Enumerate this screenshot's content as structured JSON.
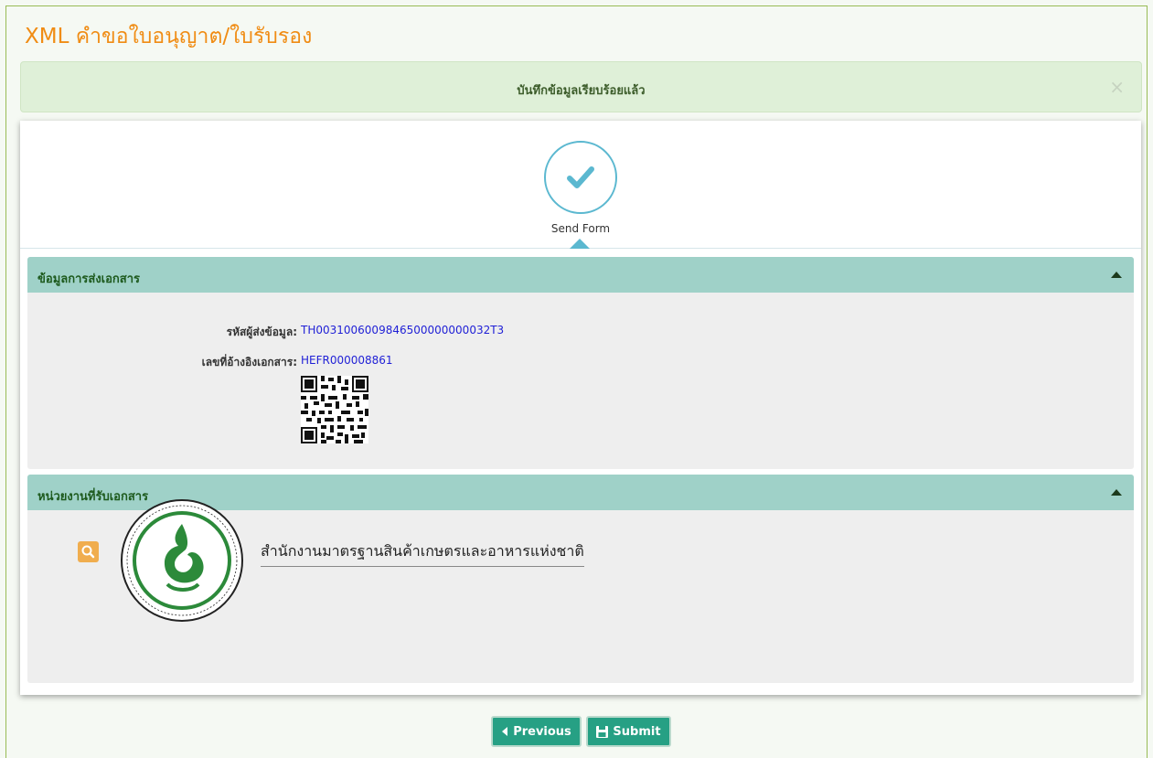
{
  "page": {
    "title": "XML คำขอใบอนุญาต/ใบรับรอง"
  },
  "alert": {
    "message": "บันทึกข้อมูลเรียบร้อยแล้ว",
    "close_symbol": "×"
  },
  "wizard": {
    "step_label": "Send Form",
    "step_icon": "check-icon",
    "accent_color": "#5bb8d0"
  },
  "sections": {
    "document_info": {
      "title": "ข้อมูลการส่งเอกสาร",
      "fields": [
        {
          "label": "รหัสผู้ส่งข้อมูล:",
          "value": "TH0031006009846500000000032T3"
        },
        {
          "label": "เลขที่อ้างอิงเอกสาร:",
          "value": "HEFR000008861"
        }
      ],
      "qr_icon": "qr-code-icon"
    },
    "receiving_agency": {
      "title": "หน่วยงานที่รับเอกสาร",
      "agency_name": "สำนักงานมาตรฐานสินค้าเกษตรและอาหารแห่งชาติ",
      "seal_text": "สำนักงานมาตรฐานสินค้าเกษตรและอาหารแห่งชาติ",
      "search_icon": "search-icon"
    }
  },
  "footer": {
    "previous_label": "Previous",
    "submit_label": "Submit",
    "button_color": "#26a084"
  },
  "colors": {
    "title": "#f08c14",
    "panel_header": "#9fd1c8",
    "alert_bg": "#dff0d8"
  }
}
